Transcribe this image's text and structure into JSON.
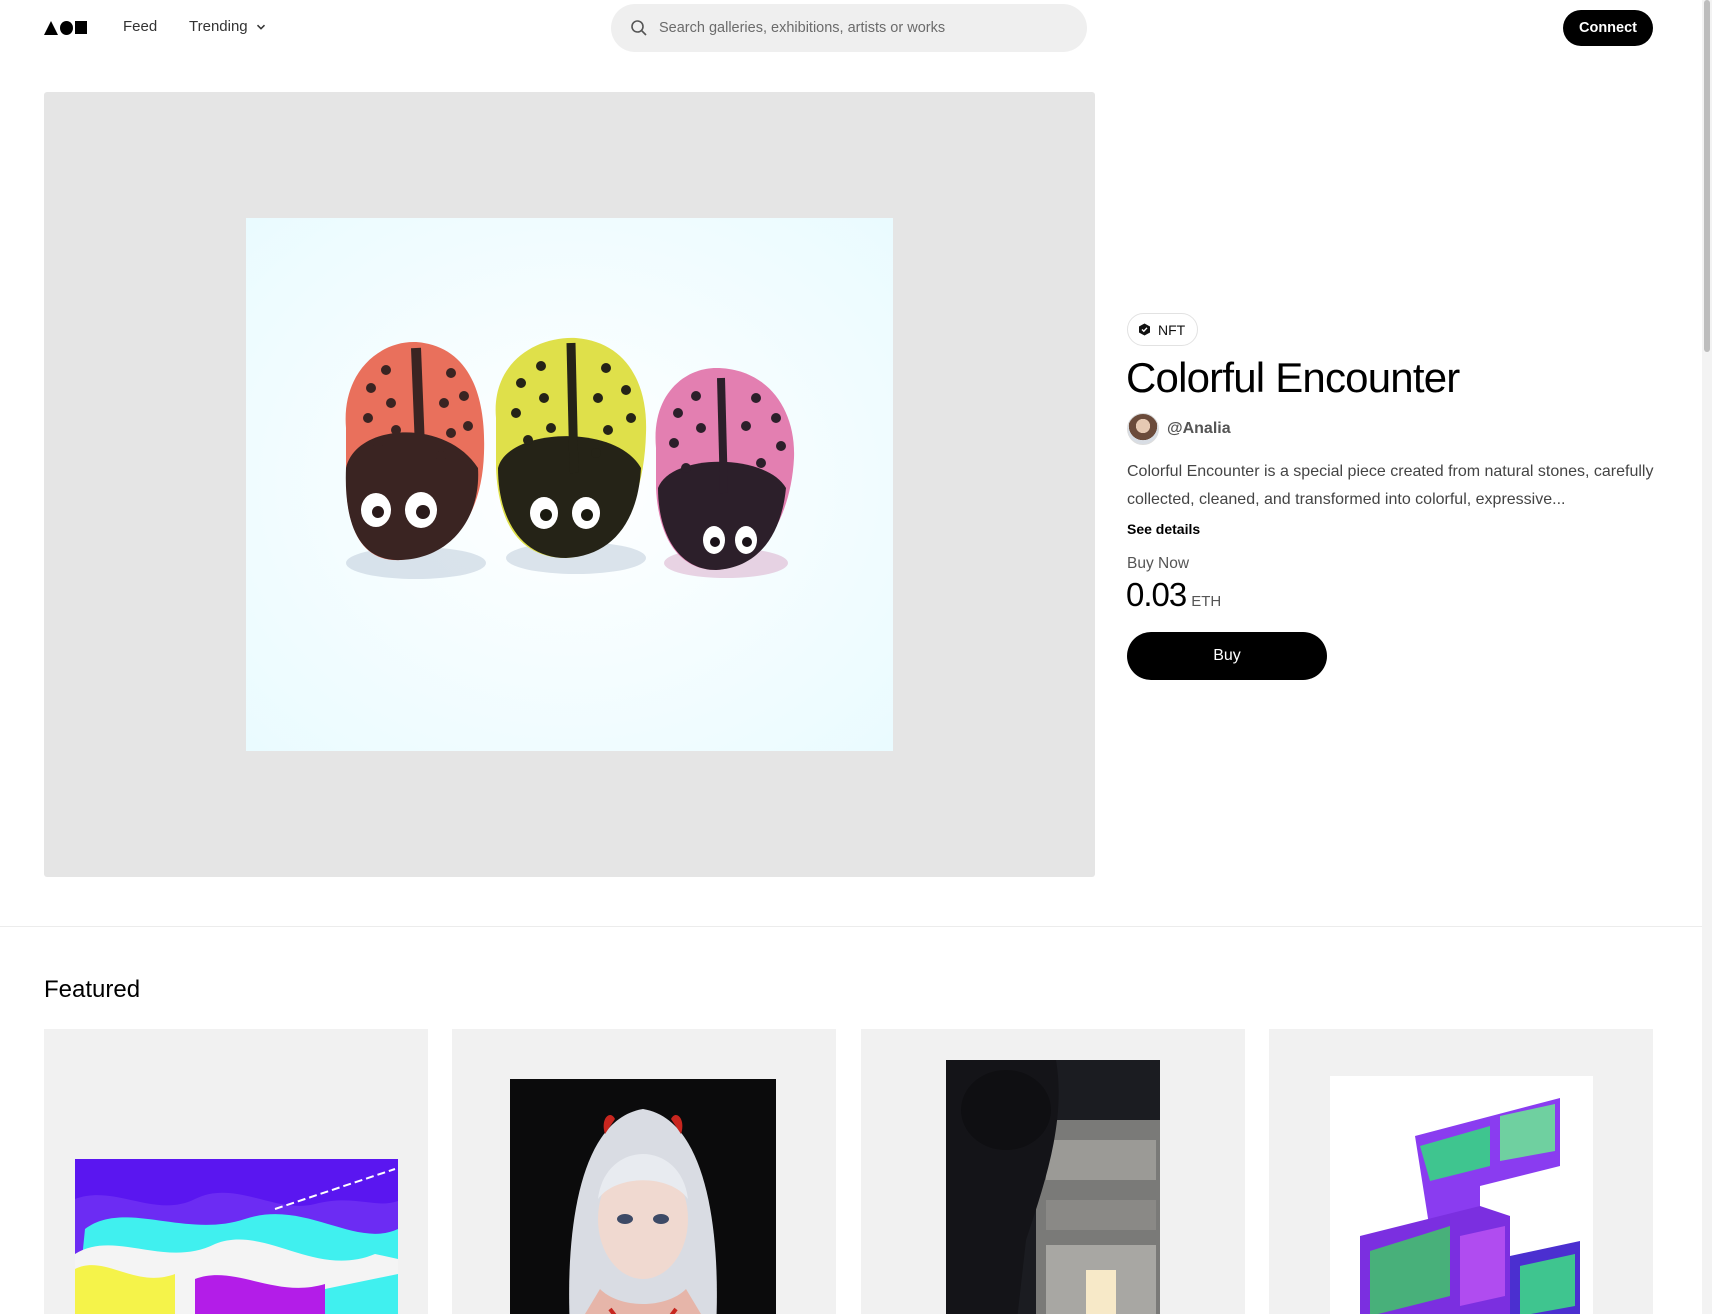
{
  "header": {
    "logo": "logo-shapes",
    "nav_feed": "Feed",
    "nav_trending": "Trending",
    "search_placeholder": "Search galleries, exhibitions, artists or works",
    "connect_label": "Connect"
  },
  "artwork": {
    "badge": "NFT",
    "title": "Colorful Encounter",
    "artist": "@Analia",
    "description": "Colorful Encounter is a special piece created from natural stones, carefully collected, cleaned, and transformed into colorful, expressive...",
    "see_details": "See details",
    "buy_now_label": "Buy Now",
    "price": "0.03",
    "currency": "ETH",
    "buy_label": "Buy"
  },
  "featured": {
    "title": "Featured",
    "cards": [
      {
        "name": "glitch-map-art"
      },
      {
        "name": "anime-girl-art"
      },
      {
        "name": "fridge-video-art"
      },
      {
        "name": "psychedelic-ribbon-art"
      }
    ]
  },
  "colors": {
    "accent": "#000000",
    "frame_bg": "#e5e5e5",
    "card_bg": "#f1f1f1"
  }
}
